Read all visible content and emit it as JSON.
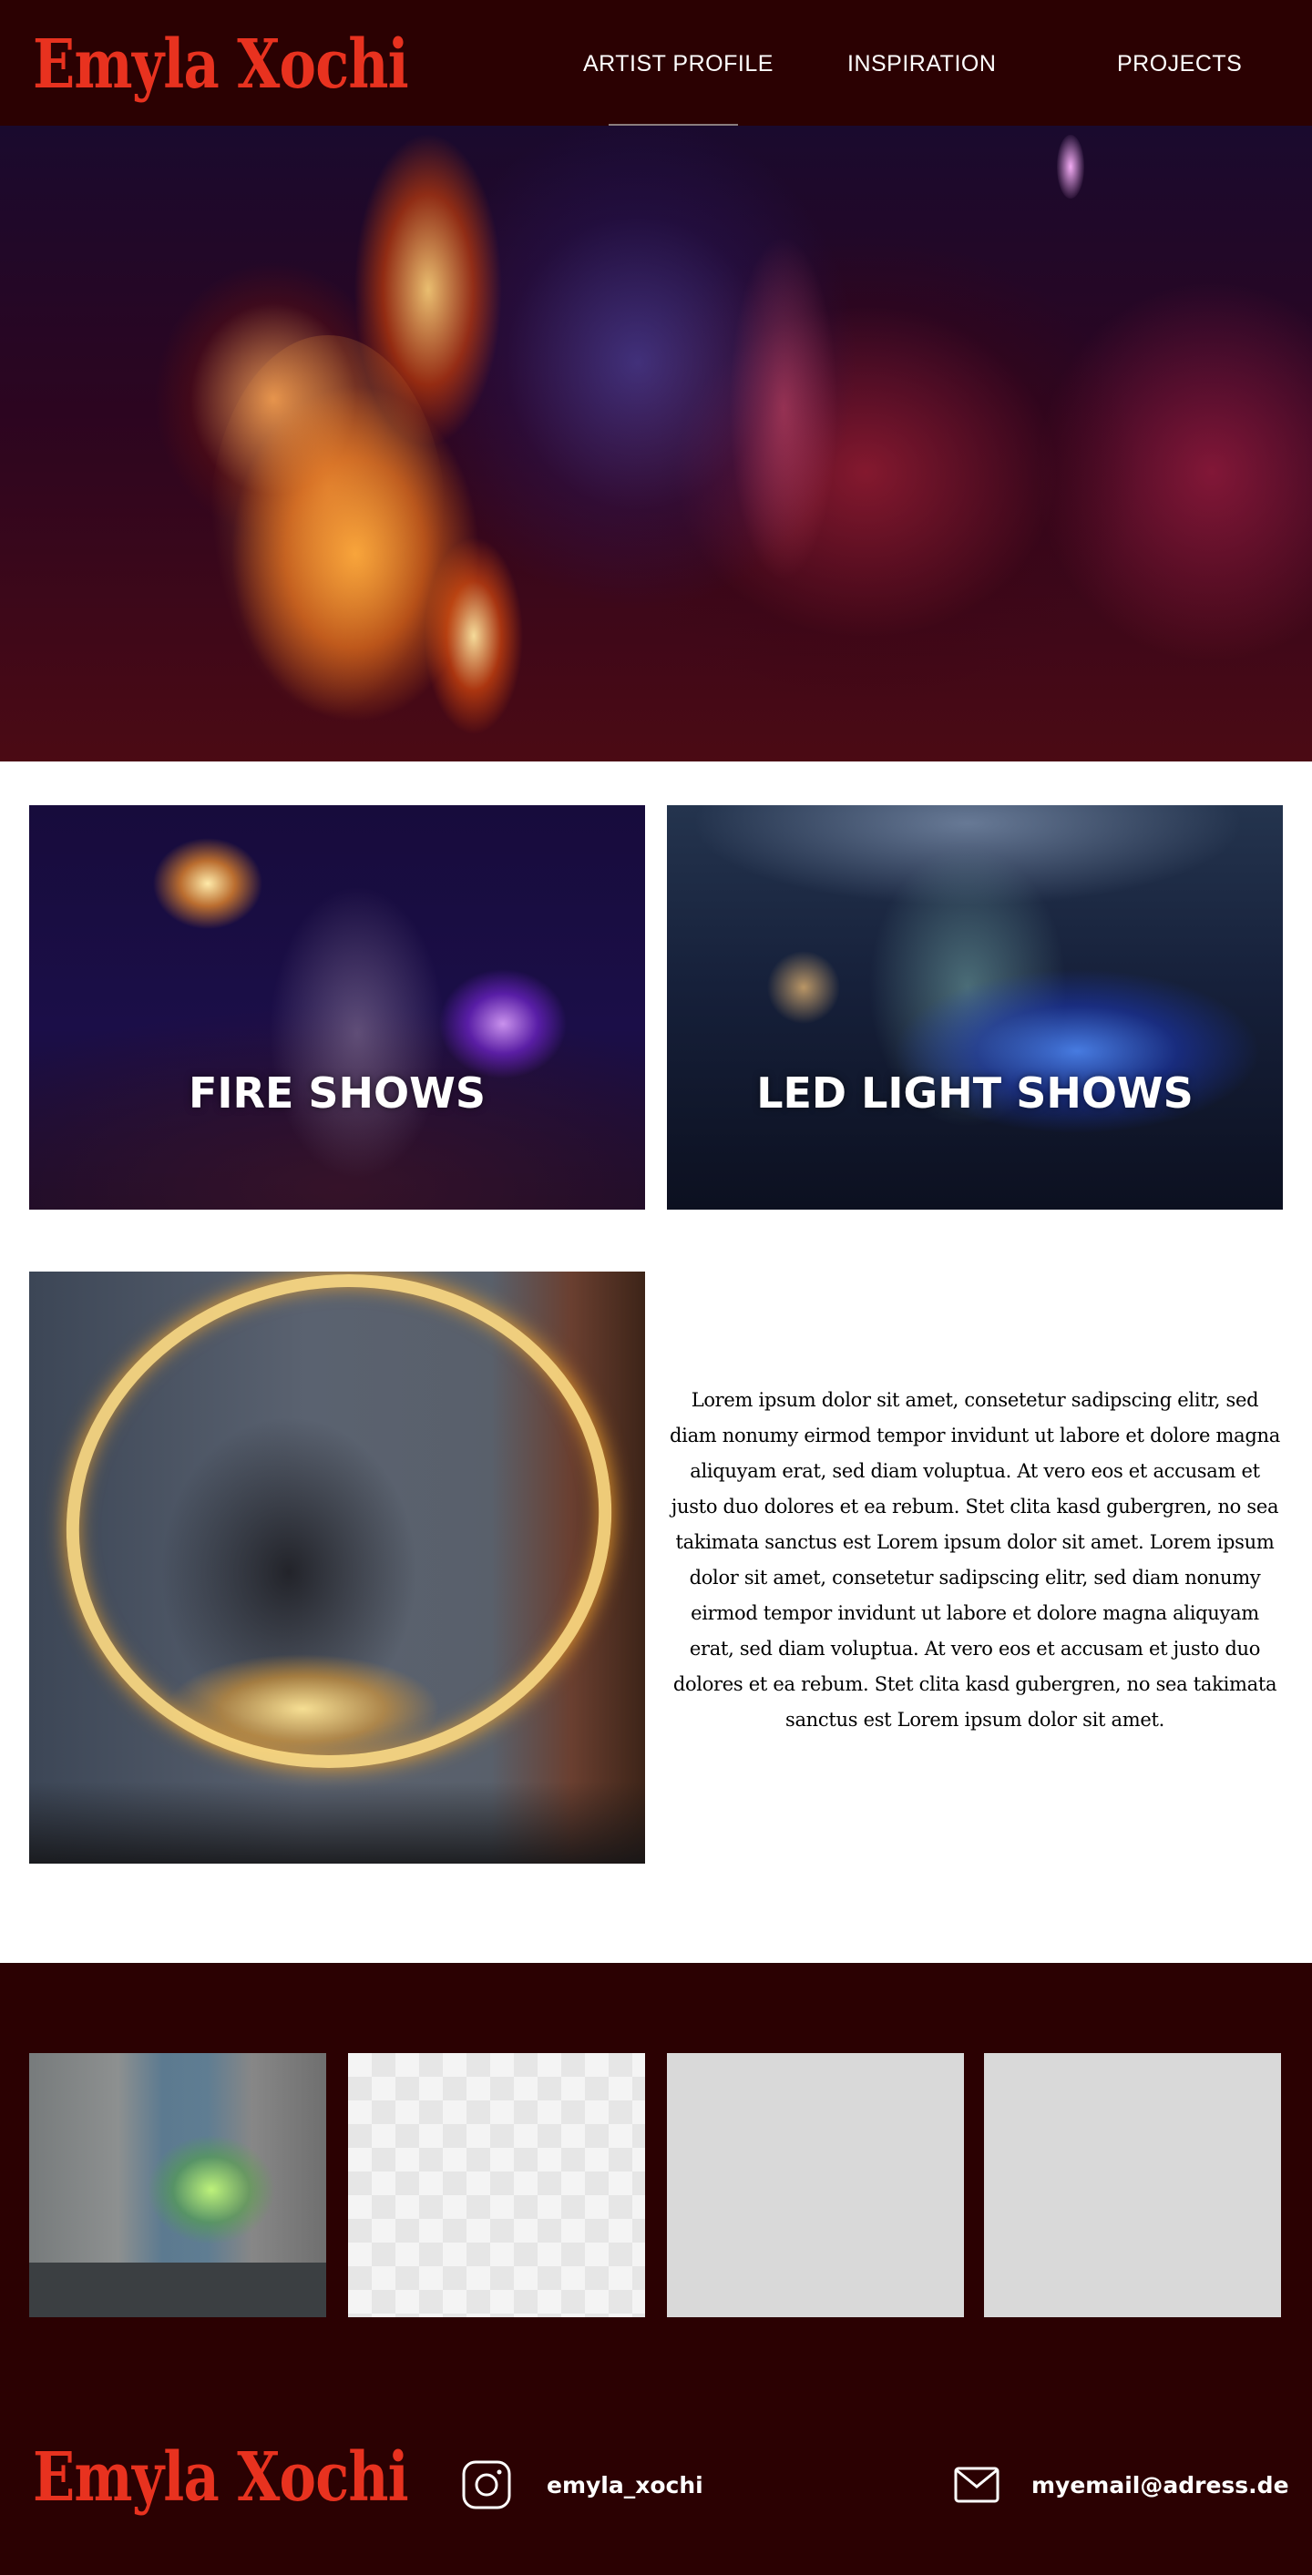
{
  "header": {
    "logo": "Emyla Xochi",
    "nav": [
      {
        "label": "ARTIST PROFILE"
      },
      {
        "label": "INSPIRATION"
      },
      {
        "label": "PROJECTS"
      }
    ]
  },
  "cards": [
    {
      "title": "FIRE SHOWS"
    },
    {
      "title": "LED LIGHT SHOWS"
    }
  ],
  "about": {
    "text": "Lorem ipsum dolor sit amet, consetetur sadipscing elitr, sed diam nonumy eirmod tempor invidunt ut labore et dolore magna aliquyam erat, sed diam voluptua. At vero eos et accusam et justo duo dolores et ea rebum. Stet clita kasd gubergren, no sea takimata sanctus est Lorem ipsum dolor sit amet. Lorem ipsum dolor sit amet, consetetur sadipscing elitr, sed diam nonumy eirmod tempor invidunt ut labore et dolore magna aliquyam erat, sed diam voluptua. At vero eos et accusam et justo duo dolores et ea rebum. Stet clita kasd gubergren, no sea takimata sanctus est Lorem ipsum dolor sit amet."
  },
  "footer": {
    "logo": "Emyla Xochi",
    "instagram": {
      "handle": "emyla_xochi",
      "icon": "instagram-icon"
    },
    "email": {
      "address": "myemail@adress.de",
      "icon": "mail-icon"
    }
  },
  "colors": {
    "header_bg": "#2b0102",
    "logo_red": "#e8321f",
    "placeholder_gray": "#d9d9d9"
  }
}
